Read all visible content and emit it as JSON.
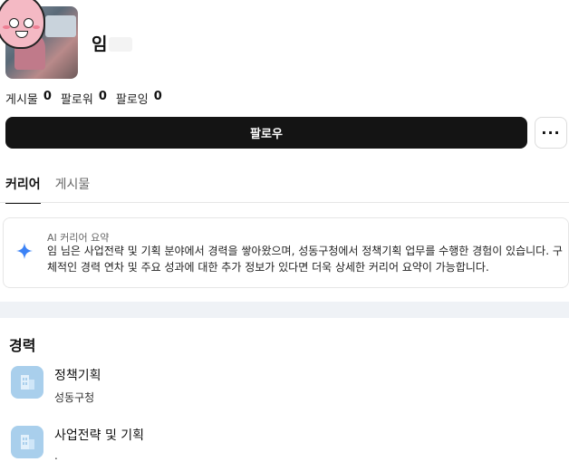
{
  "profile": {
    "name": "임",
    "stats": [
      {
        "label": "게시물",
        "value": "0"
      },
      {
        "label": "팔로워",
        "value": "0"
      },
      {
        "label": "팔로잉",
        "value": "0"
      }
    ],
    "follow_label": "팔로우",
    "more_label": "···"
  },
  "tabs": [
    {
      "label": "커리어",
      "active": true
    },
    {
      "label": "게시물",
      "active": false
    }
  ],
  "summary": {
    "label": "AI 커리어 요약",
    "text": "임 님은 사업전략 및 기획 분야에서 경력을 쌓아왔으며, 성동구청에서 정책기획 업무를 수행한 경험이 있습니다. 구체적인 경력 연차 및 주요 성과에 대한 추가 정보가 있다면 더욱 상세한 커리어 요약이 가능합니다."
  },
  "career": {
    "title": "경력",
    "items": [
      {
        "role": "정책기획",
        "org": "성동구청"
      },
      {
        "role": "사업전략 및 기획",
        "org": "."
      }
    ]
  },
  "colors": {
    "button_dark": "#141414",
    "accent_blue": "#3b82f6",
    "logo_bg": "#a9cfec"
  }
}
